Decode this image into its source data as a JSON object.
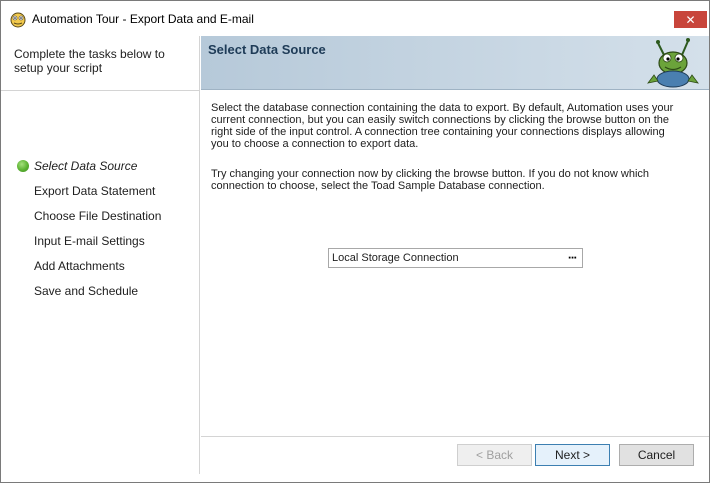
{
  "window": {
    "title": "Automation Tour - Export Data and E-mail",
    "close_label": "✕"
  },
  "sidebar": {
    "intro": "Complete the tasks below to setup your script",
    "steps": [
      {
        "label": "Select Data Source",
        "active": true
      },
      {
        "label": "Export Data Statement",
        "active": false
      },
      {
        "label": "Choose File Destination",
        "active": false
      },
      {
        "label": "Input E-mail Settings",
        "active": false
      },
      {
        "label": "Add Attachments",
        "active": false
      },
      {
        "label": "Save and Schedule",
        "active": false
      }
    ]
  },
  "header": {
    "title": "Select Data Source"
  },
  "content": {
    "paragraph1": "Select the database connection containing the data to export. By default, Automation uses your current connection, but you can easily switch connections by clicking the browse button on the right side of the input control. A connection tree containing your connections displays allowing you to choose a connection to export data.",
    "paragraph2": "Try changing your connection now by clicking the browse button. If you do not know which connection to choose, select the Toad Sample Database connection.",
    "connection_value": "Local Storage Connection",
    "browse_label": "···"
  },
  "footer": {
    "back_label": "< Back",
    "next_label": "Next >",
    "cancel_label": "Cancel"
  },
  "colors": {
    "header_gradient_start": "#b6c9d9",
    "header_title": "#1e3b57",
    "close_button": "#c8453b",
    "step_active_dot": "#5bb232"
  }
}
